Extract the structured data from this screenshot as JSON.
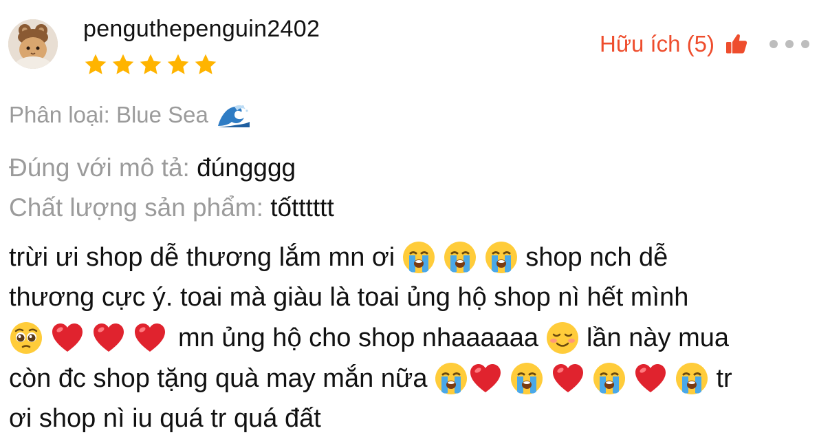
{
  "review": {
    "username": "penguthepenguin2402",
    "rating": 5,
    "rating_max": 5,
    "helpful_label": "Hữu ích (5)",
    "variation_label": "Phân loại: Blue Sea",
    "attributes": [
      {
        "key": "Đúng với mô tả:",
        "value": "đúngggg"
      },
      {
        "key": "Chất lượng sản phẩm:",
        "value": "tốtttttt"
      }
    ],
    "text_segments": {
      "l1a": "trừi ưi shop dễ thương lắm mn ơi",
      "l1b": "shop nch dễ",
      "l2": "thương cực ý. toai mà giàu là toai ủng hộ shop nì hết mình",
      "l3a": "mn ủng hộ cho shop nhaaaaaa",
      "l3b": "lần này mua",
      "l4a": "còn đc shop tặng quà may mắn nữa",
      "l4b": "tr",
      "l5": "ơi shop nì iu quá tr quá đất"
    }
  },
  "colors": {
    "accent": "#ee4d2d",
    "star": "#ffb400",
    "muted": "#9b9b9b"
  },
  "icons": [
    "avatar-cat-icon",
    "star-icon",
    "thumbs-up-icon",
    "more-dots-icon",
    "wave-emoji-icon",
    "crying-face-emoji-icon",
    "red-heart-emoji-icon",
    "pleading-face-emoji-icon",
    "smiling-blush-emoji-icon"
  ]
}
